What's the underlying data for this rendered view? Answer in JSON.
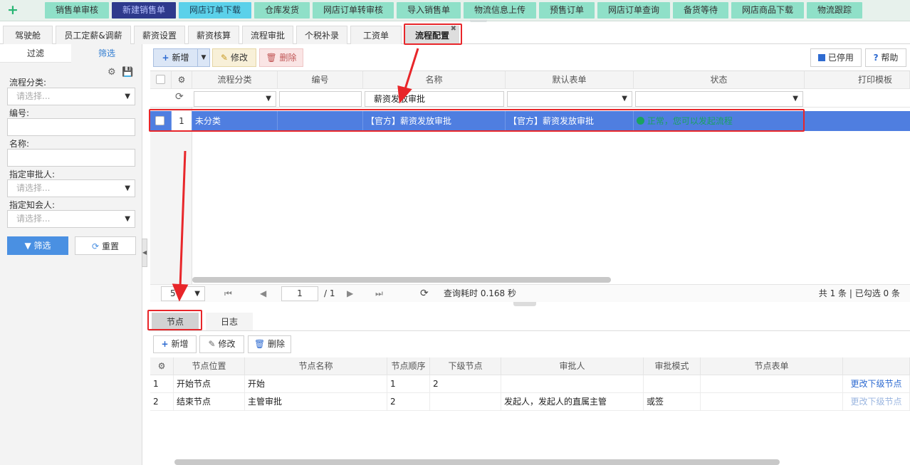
{
  "topbar": {
    "buttons": [
      "销售单审核",
      "新建销售单",
      "网店订单下载",
      "仓库发货",
      "网店订单转审核",
      "导入销售单",
      "物流信息上传",
      "预售订单",
      "网店订单查询",
      "备货等待",
      "网店商品下载",
      "物流跟踪"
    ]
  },
  "tabs": [
    "驾驶舱",
    "员工定薪&调薪",
    "薪资设置",
    "薪资核算",
    "流程审批",
    "个税补录",
    "工资单",
    "流程配置"
  ],
  "left_panel": {
    "tab_filter": "过滤",
    "tab_screen": "筛选",
    "fields": [
      {
        "label": "流程分类:",
        "placeholder": "请选择..."
      },
      {
        "label": "编号:",
        "placeholder": ""
      },
      {
        "label": "名称:",
        "placeholder": ""
      },
      {
        "label": "指定审批人:",
        "placeholder": "请选择..."
      },
      {
        "label": "指定知会人:",
        "placeholder": "请选择..."
      }
    ],
    "filter_button": "筛选",
    "reset_button": "重置"
  },
  "toolbar": {
    "add": "新增",
    "edit": "修改",
    "delete": "删除",
    "disabled": "已停用",
    "help": "帮助"
  },
  "grid": {
    "columns": [
      "流程分类",
      "编号",
      "名称",
      "默认表单",
      "状态",
      "打印模板"
    ],
    "name_filter": "薪资发放审批",
    "row": {
      "index": "1",
      "category": "未分类",
      "code": "",
      "name": "【官方】薪资发放审批",
      "form": "【官方】薪资发放审批",
      "status": "正常，您可以发起流程"
    }
  },
  "pager": {
    "page_size": "5",
    "page": "1",
    "total_pages": "/ 1",
    "query_time": "查询耗时 0.168 秒",
    "summary": "共 1 条 | 已勾选 0 条"
  },
  "bottom": {
    "tab_nodes": "节点",
    "tab_log": "日志",
    "add": "新增",
    "edit": "修改",
    "delete": "删除",
    "columns": [
      "节点位置",
      "节点名称",
      "节点顺序",
      "下级节点",
      "审批人",
      "审批模式",
      "节点表单"
    ],
    "rows": [
      {
        "index": "1",
        "position": "开始节点",
        "name": "开始",
        "order": "1",
        "next": "2",
        "approver": "",
        "mode": "",
        "form": "",
        "action": "更改下级节点"
      },
      {
        "index": "2",
        "position": "结束节点",
        "name": "主管审批",
        "order": "2",
        "next": "",
        "approver": "发起人，发起人的直属主管",
        "mode": "或签",
        "form": "",
        "action": "更改下级节点"
      }
    ]
  },
  "colors": {
    "accent": "#4f7ee0",
    "annotation": "#e8262a",
    "status_ok": "#1aa260"
  }
}
